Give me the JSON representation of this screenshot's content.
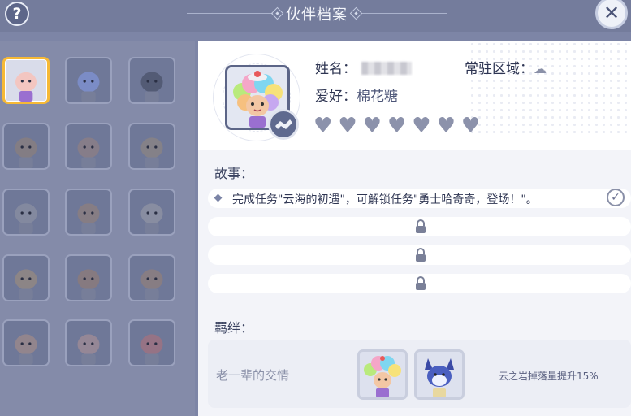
{
  "header": {
    "title": "伙伴档案",
    "help_label": "?",
    "close_label": "✕"
  },
  "grid": {
    "items": [
      {
        "name": "sheep-cotton",
        "selected": true,
        "color": "#f3c6c1"
      },
      {
        "name": "blue-wolf",
        "color": "#7f93d6"
      },
      {
        "name": "penguin",
        "color": "#4a5169"
      },
      {
        "name": "deer",
        "color": "#8a7f7e"
      },
      {
        "name": "deer-2",
        "color": "#8e7f84"
      },
      {
        "name": "deer-3",
        "color": "#8b8483"
      },
      {
        "name": "gray-cat",
        "color": "#8a8fa2"
      },
      {
        "name": "squirrel",
        "color": "#8d7f7d"
      },
      {
        "name": "gray-dog",
        "color": "#9094a4"
      },
      {
        "name": "beige-cat",
        "color": "#958a80"
      },
      {
        "name": "moose",
        "color": "#8d7b78"
      },
      {
        "name": "bull",
        "color": "#8f7f7c"
      },
      {
        "name": "pink-pig",
        "color": "#9e8a8a"
      },
      {
        "name": "pink-girl",
        "color": "#a28c96"
      },
      {
        "name": "red-deer",
        "color": "#a3727f"
      }
    ]
  },
  "profile": {
    "name_label": "姓名：",
    "region_label": "常驻区域：",
    "region_icon": "☁",
    "hobby_label": "爱好：",
    "hobby_value": "棉花糖",
    "hearts_filled": 7,
    "hearts_total": 7
  },
  "story": {
    "title": "故事：",
    "items": [
      {
        "text": "完成任务\"云海的初遇\"，可解锁任务\"勇士哈奇奇，登场！\"。",
        "completed": true
      },
      {
        "locked": true
      },
      {
        "locked": true
      },
      {
        "locked": true
      }
    ]
  },
  "bond": {
    "title": "羁绊：",
    "name": "老一辈的交情",
    "effect": "云之岩掉落量提升15%"
  },
  "colors": {
    "accent_selected": "#f6b936",
    "panel_bg": "#f3f4f9"
  }
}
